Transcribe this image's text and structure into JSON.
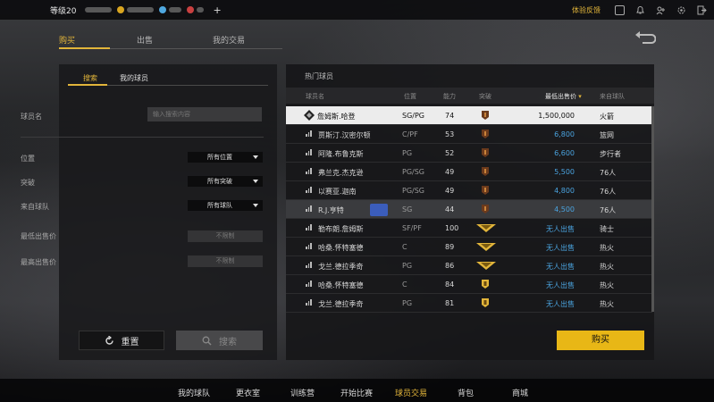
{
  "topbar": {
    "level": "等级20",
    "plus": "+",
    "feedback": "体验反馈",
    "icons": [
      "portrait-icon",
      "bell-icon",
      "friends-icon",
      "settings-icon",
      "exit-icon"
    ]
  },
  "tabs": [
    {
      "label": "购买",
      "active": true
    },
    {
      "label": "出售",
      "active": false
    },
    {
      "label": "我的交易",
      "active": false
    }
  ],
  "left_panel": {
    "tabs": [
      {
        "label": "搜索",
        "active": true
      },
      {
        "label": "我的球员",
        "active": false
      }
    ],
    "player_name_label": "球员名",
    "player_name_placeholder": "输入搜索内容",
    "position_label": "位置",
    "position_value": "所有位置",
    "breakthrough_label": "突破",
    "breakthrough_value": "所有突破",
    "team_label": "来自球队",
    "team_value": "所有球队",
    "min_price_label": "最低出售价",
    "min_price_value": "不限制",
    "max_price_label": "最高出售价",
    "max_price_value": "不限制",
    "reset_label": "重置",
    "search_label": "搜索"
  },
  "right_panel": {
    "title": "热门球员",
    "columns": {
      "name": "球员名",
      "position": "位置",
      "ability": "能力",
      "breakthrough": "突破",
      "min_price": "最低出售价",
      "team": "来自球队"
    },
    "rows": [
      {
        "name": "詹姆斯.哈登",
        "position": "SG/PG",
        "ability": "74",
        "price": "1,500,000",
        "team": "火箭",
        "badge": "bronze"
      },
      {
        "name": "贾斯汀.汉密尔顿",
        "position": "C/PF",
        "ability": "53",
        "price": "6,800",
        "team": "篮网",
        "badge": "bronze"
      },
      {
        "name": "阿隆.布鲁克斯",
        "position": "PG",
        "ability": "52",
        "price": "6,600",
        "team": "步行者",
        "badge": "bronze"
      },
      {
        "name": "弗兰克.杰克逊",
        "position": "PG/SG",
        "ability": "49",
        "price": "5,500",
        "team": "76人",
        "badge": "bronze"
      },
      {
        "name": "以赛亚.迦南",
        "position": "PG/SG",
        "ability": "49",
        "price": "4,800",
        "team": "76人",
        "badge": "bronze"
      },
      {
        "name": "R.J.亨特",
        "position": "SG",
        "ability": "44",
        "price": "4,500",
        "team": "76人",
        "badge": "bronze"
      },
      {
        "name": "勒布朗.詹姆斯",
        "position": "SF/PF",
        "ability": "100",
        "price": "无人出售",
        "team": "骑士",
        "badge": "gold-wing"
      },
      {
        "name": "哈桑.怀特塞德",
        "position": "C",
        "ability": "89",
        "price": "无人出售",
        "team": "热火",
        "badge": "gold-wing"
      },
      {
        "name": "戈兰.德拉季奇",
        "position": "PG",
        "ability": "86",
        "price": "无人出售",
        "team": "热火",
        "badge": "gold-wing"
      },
      {
        "name": "哈桑.怀特塞德",
        "position": "C",
        "ability": "84",
        "price": "无人出售",
        "team": "热火",
        "badge": "gold"
      },
      {
        "name": "戈兰.德拉季奇",
        "position": "PG",
        "ability": "81",
        "price": "无人出售",
        "team": "热火",
        "badge": "gold"
      }
    ],
    "buy_label": "购买"
  },
  "bottom_nav": [
    {
      "label": "我的球队",
      "active": false
    },
    {
      "label": "更衣室",
      "active": false
    },
    {
      "label": "训练营",
      "active": false
    },
    {
      "label": "开始比赛",
      "active": false
    },
    {
      "label": "球员交易",
      "active": true
    },
    {
      "label": "背包",
      "active": false
    },
    {
      "label": "商城",
      "active": false
    }
  ],
  "colors": {
    "accent": "#e2b53a",
    "price": "#4aa3df",
    "buy_button": "#e8b716"
  }
}
